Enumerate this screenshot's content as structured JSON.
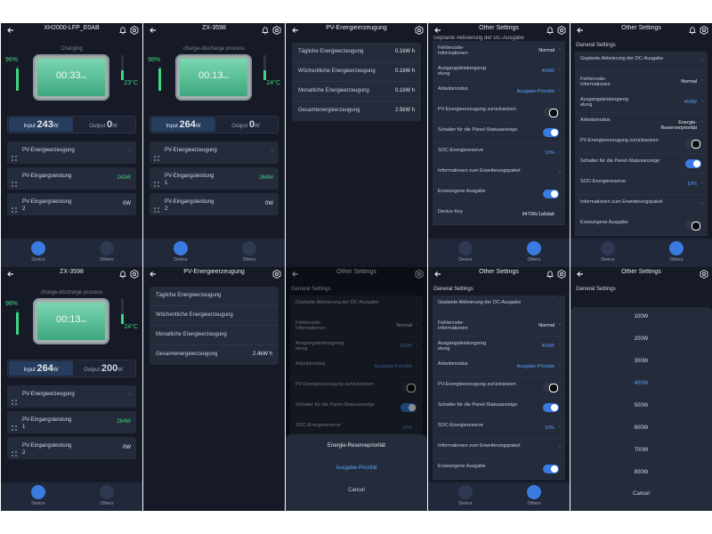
{
  "s1": {
    "title": "XH2000-LFP_E0AB",
    "status": "Charging",
    "soc": "96%",
    "temp": "23°C",
    "time": "00:33",
    "time_unit": "min",
    "input_label": "Input",
    "input_value": "243",
    "unit": "W",
    "output_label": "Output",
    "output_value": "0",
    "card1": "PV-Energieerzeugung",
    "card2": "PV-Eingangsleistung",
    "card2_val": "243W",
    "card3": "PV-Eingangsleistung\n2",
    "card3_val": "0W"
  },
  "s2": {
    "title": "ZX-3598",
    "status": "charge-discharge process",
    "soc": "98%",
    "temp": "24°C",
    "time": "00:13",
    "time_unit": "min",
    "input_label": "Input",
    "input_value": "264",
    "unit": "W",
    "output_label": "Output",
    "output_value": "0",
    "card1": "PV-Energieerzeugung",
    "card2": "PV-Eingangsleistung\n1",
    "card2_val": "264W",
    "card3": "PV-Eingangsleistung\n2",
    "card3_val": "0W"
  },
  "s3": {
    "title": "PV-Energieerzeugung",
    "rows": [
      {
        "k": "Tägliche Energieerzeugung",
        "v": "0.1kW h"
      },
      {
        "k": "Wöchentliche Energieerzeugung",
        "v": "0.1kW h"
      },
      {
        "k": "Monatliche Energieerzeugung",
        "v": "0.1kW h"
      },
      {
        "k": "Gesamtenergieerzeugung",
        "v": "2.5kW h"
      }
    ]
  },
  "s4": {
    "title": "Other Settings",
    "top_cut": "Geplante Aktivierung der DC-Ausgabe",
    "rows": [
      {
        "k": "Fehlercode-\nInformationen",
        "v": "Normal"
      },
      {
        "k": "Ausgangsleistungsreg\nelung",
        "v": "400W"
      },
      {
        "k": "Arbeitsmodus",
        "v": "Ausgabe-Priorität"
      },
      {
        "k": "PV-Energieerzeugung zurücksetzen",
        "v": ""
      },
      {
        "k": "Schalter für die Panel-Statusanzeige",
        "v": ""
      },
      {
        "k": "SOC-Energiereserve",
        "v": "10%"
      },
      {
        "k": "Informationen zum Erweiterungspaket",
        "v": ""
      },
      {
        "k": "Erzwungene Ausgabe",
        "v": ""
      },
      {
        "k": "Device Key",
        "v": "94706c1a6dab"
      }
    ]
  },
  "s5": {
    "title": "Other Settings",
    "section": "General Settings",
    "rows": [
      {
        "k": "Geplante Aktivierung der DC-Ausgabe",
        "v": ""
      },
      {
        "k": "Fehlercode-\nInformationen",
        "v": "Normal"
      },
      {
        "k": "Ausgangsleistungsreg\nelung",
        "v": "400W"
      },
      {
        "k": "Arbeitsmodus",
        "v": "Energie-\nReserverpriorität"
      },
      {
        "k": "PV-Energieerzeugung zurücksetzen",
        "v": ""
      },
      {
        "k": "Schalter für die Panel-Statusanzeige",
        "v": ""
      },
      {
        "k": "SOC-Energiereserve",
        "v": "10%"
      },
      {
        "k": "Informationen zum Erweiterungspaket",
        "v": ""
      },
      {
        "k": "Erzwungene Ausgabe",
        "v": ""
      }
    ]
  },
  "s6": {
    "title": "ZX-3598",
    "status": "charge-discharge process",
    "soc": "98%",
    "temp": "24°C",
    "time": "00:13",
    "time_unit": "min",
    "input_label": "Input",
    "input_value": "264",
    "unit": "W",
    "output_label": "Output",
    "output_value": "200",
    "card1": "PV-Energieerzeugung",
    "card2": "PV-Eingangsleistung\n1",
    "card2_val": "264W",
    "card3": "PV-Eingangsleistung\n2",
    "card3_val": "0W"
  },
  "s7": {
    "title": "PV-Energieerzeugung",
    "rows": [
      {
        "k": "Tägliche Energieerzeugung",
        "v": ""
      },
      {
        "k": "Wöchentliche Energieerzeugung",
        "v": ""
      },
      {
        "k": "Monatliche Energieerzeugung",
        "v": ""
      },
      {
        "k": "Gesamtenergieerzeugung",
        "v": "2.4kW h"
      }
    ]
  },
  "s8": {
    "title": "Other Settings",
    "section": "General Settings",
    "rows": [
      {
        "k": "Geplante Aktivierung der DC-Ausgabe",
        "v": ""
      },
      {
        "k": "Fehlercode-\nInformationen",
        "v": "Normal"
      },
      {
        "k": "Ausgangsleistungsreg\nelung",
        "v": "200W"
      },
      {
        "k": "Arbeitsmodus",
        "v": "Ausgabe-Priorität"
      },
      {
        "k": "PV-Energieerzeugung zurücksetzen",
        "v": ""
      },
      {
        "k": "Schalter für die Panel-Statusanzeige",
        "v": ""
      },
      {
        "k": "SOC-Energiereserve",
        "v": "10%"
      }
    ],
    "sheet_title": "Energie-Reservepriorität",
    "sheet_option": "Ausgabe-Priorität",
    "sheet_cancel": "Cancel"
  },
  "s9": {
    "title": "Other Settings",
    "section": "General Settings",
    "rows": [
      {
        "k": "Geplante Aktivierung der DC-Ausgabe",
        "v": ""
      },
      {
        "k": "Fehlercode-\nInformationen",
        "v": "Normal"
      },
      {
        "k": "Ausgangsleistungsreg\nelung",
        "v": "400W"
      },
      {
        "k": "Arbeitsmodus",
        "v": "Ausgabe-Priorität"
      },
      {
        "k": "PV-Energieerzeugung zurücksetzen",
        "v": ""
      },
      {
        "k": "Schalter für die Panel-Statusanzeige",
        "v": ""
      },
      {
        "k": "SOC-Energiereserve",
        "v": "10%"
      },
      {
        "k": "Informationen zum Erweiterungspaket",
        "v": ""
      },
      {
        "k": "Erzwungene Ausgabe",
        "v": ""
      }
    ]
  },
  "s10": {
    "title": "Other Settings",
    "section": "General Settings",
    "options": [
      "100W",
      "200W",
      "300W",
      "400W",
      "500W",
      "600W",
      "700W",
      "800W"
    ],
    "selected": "400W",
    "cancel": "Cancel"
  },
  "tabs": {
    "device": "Device",
    "others": "Others"
  },
  "colors": {
    "bg": "#151a26",
    "card": "#242b3b",
    "accent_blue": "#3a7be0",
    "accent_green": "#3ed67f"
  }
}
